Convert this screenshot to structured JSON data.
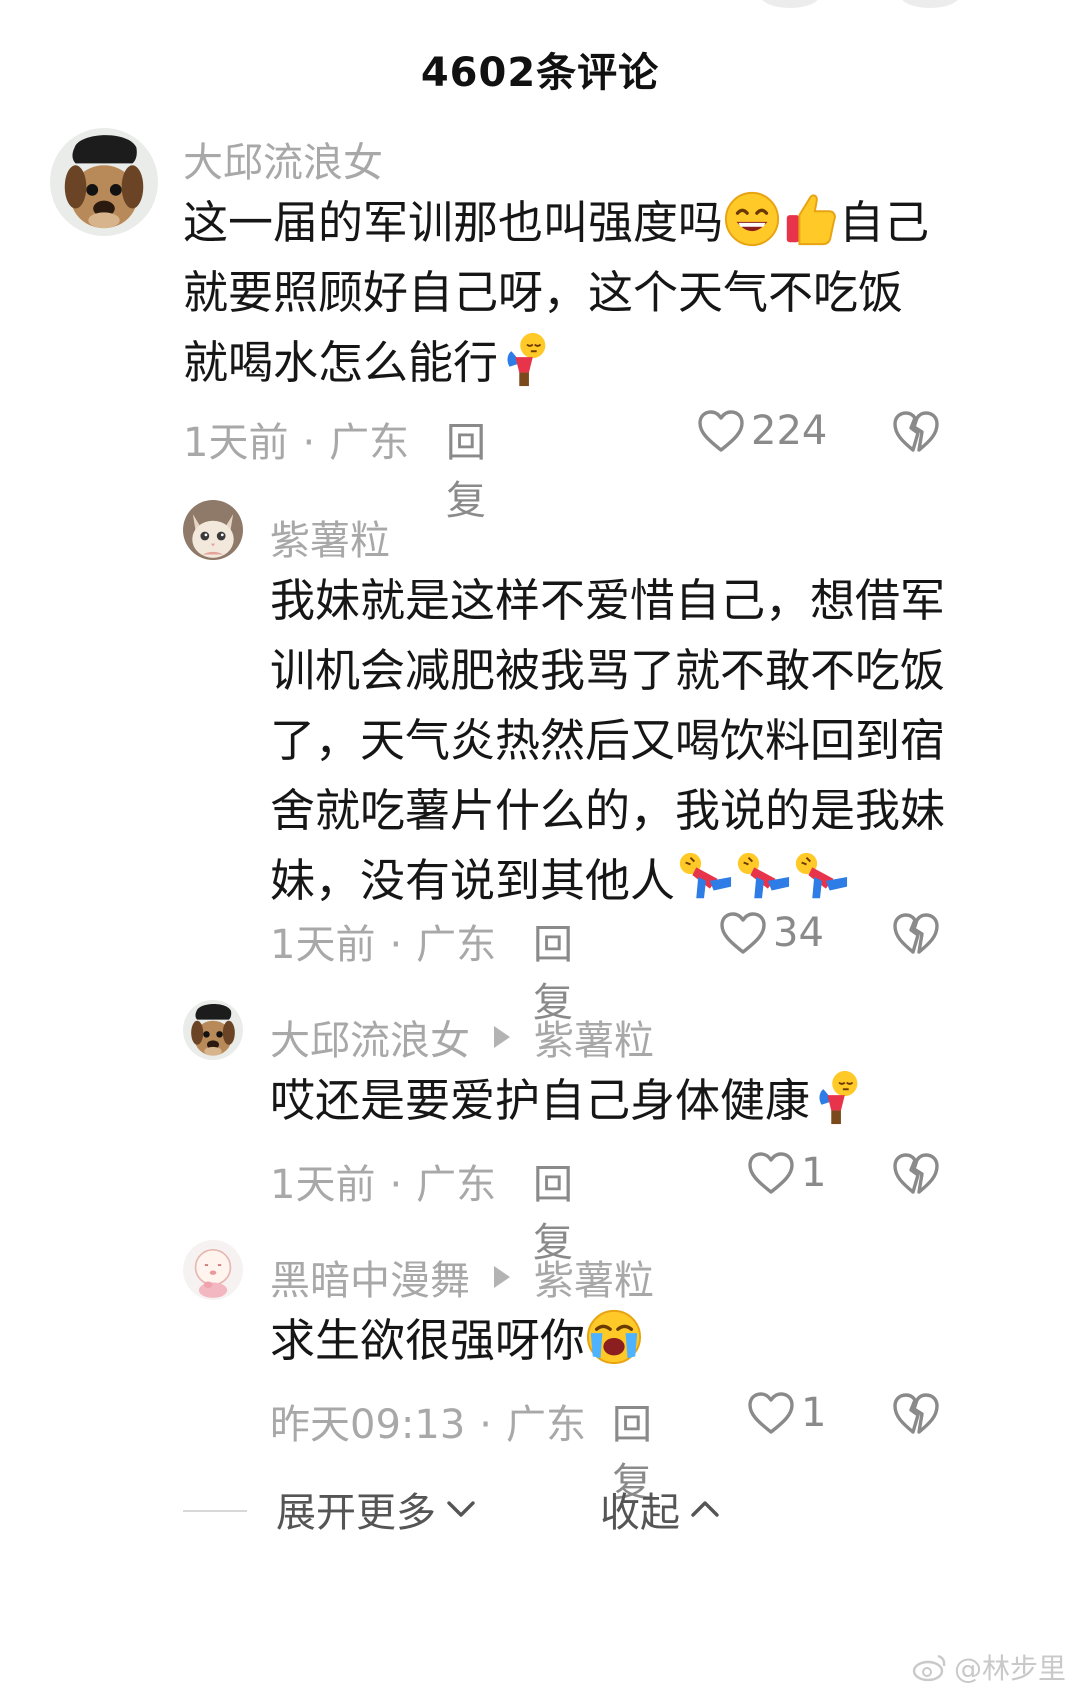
{
  "header": {
    "title": "4602条评论"
  },
  "comments": [
    {
      "author": "大邱流浪女",
      "text_lines": [
        "这一届的军训那也叫强度吗",
        "自己",
        "就要照顾好自己呀，这个天气不吃饭",
        "就喝水怎么能行"
      ],
      "time": "1天前",
      "location": "广东",
      "reply": "回复",
      "likes": "224"
    },
    {
      "author": "紫薯粒",
      "text_lines": [
        "我妹就是这样不爱惜自己，想借军",
        "训机会减肥被我骂了就不敢不吃饭",
        "了，天气炎热然后又喝饮料回到宿",
        "舍就吃薯片什么的，我说的是我妹",
        "妹，没有说到其他人"
      ],
      "time": "1天前",
      "location": "广东",
      "reply": "回复",
      "likes": "34"
    },
    {
      "author": "大邱流浪女",
      "reply_to": "紫薯粒",
      "text_lines": [
        "哎还是要爱护自己身体健康"
      ],
      "time": "1天前",
      "location": "广东",
      "reply": "回复",
      "likes": "1"
    },
    {
      "author": "黑暗中漫舞",
      "reply_to": "紫薯粒",
      "text_lines": [
        "求生欲很强呀你"
      ],
      "time": "昨天09:13",
      "location": "广东",
      "reply": "回复",
      "likes": "1"
    }
  ],
  "footer": {
    "expand_label": "展开更多",
    "collapse_label": "收起"
  },
  "watermark": {
    "text": "@林步里"
  },
  "icons": {
    "like": "heart-outline-icon",
    "dislike": "broken-heart-icon",
    "expand": "chevron-down-icon",
    "collapse": "chevron-up-icon",
    "watermark": "weibo-logo-icon"
  },
  "colors": {
    "text": "#161616",
    "secondary": "#a8a8a8",
    "action": "#8a8a8a"
  }
}
